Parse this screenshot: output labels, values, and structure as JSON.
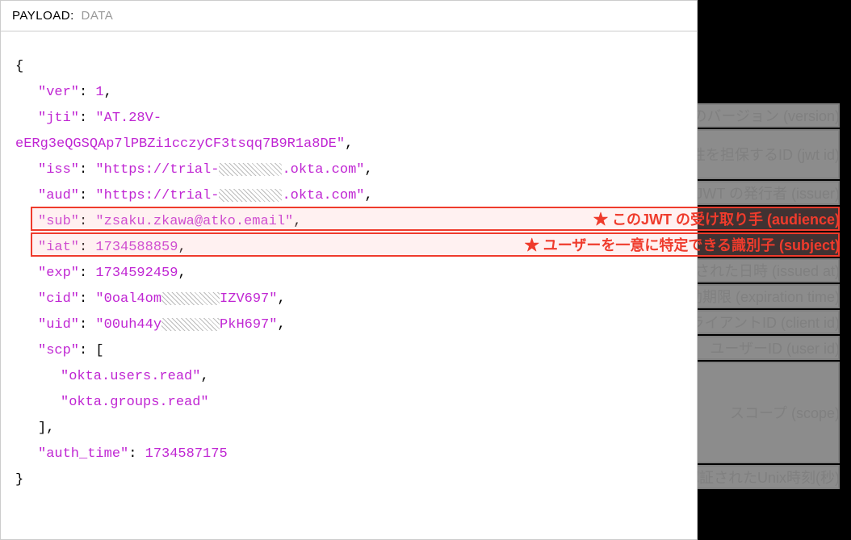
{
  "header": {
    "label": "PAYLOAD:",
    "value": "DATA"
  },
  "jwt": {
    "ver_key": "\"ver\"",
    "ver_val": "1",
    "jti_key": "\"jti\"",
    "jti_val_a": "\"AT.28V-",
    "jti_val_b": "eERg3eQGSQAp7lPBZi1cczyCF3tsqq7B9R1a8DE\"",
    "iss_key": "\"iss\"",
    "iss_val_a": "\"https://trial-",
    "iss_val_b": ".okta.com\"",
    "aud_key": "\"aud\"",
    "aud_val_a": "\"https://trial-",
    "aud_val_b": ".okta.com\"",
    "sub_key": "\"sub\"",
    "sub_val": "\"zsaku.zkawa@atko.email\"",
    "iat_key": "\"iat\"",
    "iat_val": "1734588859",
    "exp_key": "\"exp\"",
    "exp_val": "1734592459",
    "cid_key": "\"cid\"",
    "cid_val_a": "\"0oal4om",
    "cid_val_b": "IZV697\"",
    "uid_key": "\"uid\"",
    "uid_val_a": "\"00uh44y",
    "uid_val_b": "PkH697\"",
    "scp_key": "\"scp\"",
    "scp_item1": "\"okta.users.read\"",
    "scp_item2": "\"okta.groups.read\"",
    "auth_time_key": "\"auth_time\"",
    "auth_time_val": "1734587175"
  },
  "annotations": {
    "ver": "アクセストークンのバージョン (version)",
    "jti": "JWTのユニーク性を担保するID (jwt id)",
    "iss": "このJWT の発行者 (issuer)",
    "aud": "★  このJWT の受け取り手 (audience)",
    "sub": "★  ユーザーを一意に特定できる識別子 (subject)",
    "iat": "JWT が発行された日時 (issued at)",
    "exp": "JWT の有効期限 (expiration time)",
    "cid": "クライアントID (client id)",
    "uid": "ユーザーID (user id)",
    "scp": "スコープ (scope)",
    "auth_time": "ユーザーが認証されたUnix時刻(秒)"
  }
}
